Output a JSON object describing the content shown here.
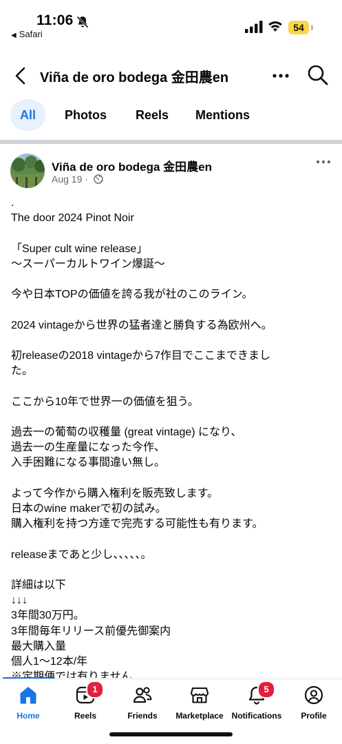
{
  "status_bar": {
    "time": "11:06",
    "back_app": "Safari",
    "battery": "54"
  },
  "header": {
    "title": "Viña de oro bodega 金田農en"
  },
  "tabs": [
    {
      "label": "All",
      "active": true
    },
    {
      "label": "Photos"
    },
    {
      "label": "Reels"
    },
    {
      "label": "Mentions"
    }
  ],
  "post": {
    "author": "Viña de oro bodega 金田農en",
    "date": "Aug 19 ·",
    "lines": [
      ".",
      "The door 2024 Pinot Noir",
      "",
      "「Super cult wine release」",
      "〜スーパーカルトワイン爆誕〜",
      "",
      "今や日本TOPの価値を誇る我が社のこのライン。",
      "",
      "2024 vintageから世界の猛者達と勝負する為欧州へ。",
      "",
      "初releaseの2018 vintageから7作目でここまできまし",
      "た。",
      "",
      "ここから10年で世界一の価値を狙う。",
      "",
      "過去一の葡萄の収穫量 (great vintage) になり、",
      "過去一の生産量になった今作、",
      "入手困難になる事間違い無し。",
      "",
      "よって今作から購入権利を販売致します。",
      "日本のwine makerで初の試み。",
      "購入権利を持つ方達で完売する可能性も有ります。",
      "",
      "releaseまであと少し、、、、、。",
      "",
      "詳細は以下",
      "↓↓↓",
      "3年間30万円。",
      "3年間毎年リリース前優先御案内",
      "最大購入量",
      "個人1〜12本/年",
      "※定期便では有りません"
    ]
  },
  "bottom_nav": {
    "items": [
      {
        "label": "Home",
        "active": true
      },
      {
        "label": "Reels",
        "badge": "1"
      },
      {
        "label": "Friends"
      },
      {
        "label": "Marketplace"
      },
      {
        "label": "Notifications",
        "badge": "5"
      },
      {
        "label": "Profile"
      }
    ]
  },
  "colors": {
    "accent": "#1b74e4",
    "badge": "#e41e3f",
    "battery": "#f7d848"
  }
}
